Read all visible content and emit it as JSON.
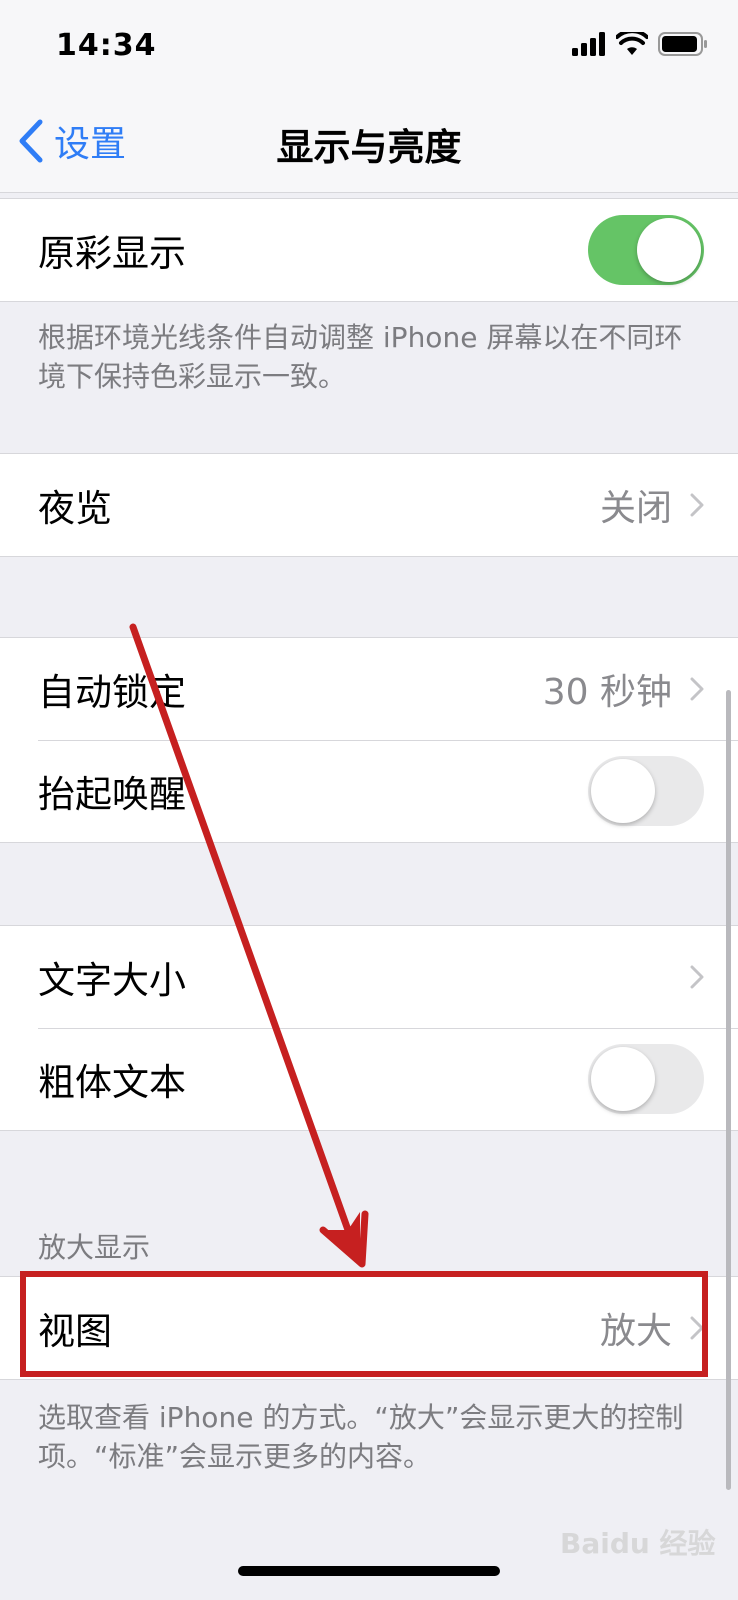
{
  "status_bar": {
    "time": "14:34"
  },
  "nav": {
    "back_label": "设置",
    "title": "显示与亮度"
  },
  "true_tone": {
    "label": "原彩显示",
    "enabled": true,
    "description": "根据环境光线条件自动调整 iPhone 屏幕以在不同环境下保持色彩显示一致。"
  },
  "night_shift": {
    "label": "夜览",
    "value": "关闭"
  },
  "lock_group": {
    "auto_lock": {
      "label": "自动锁定",
      "value": "30 秒钟"
    },
    "raise_to_wake": {
      "label": "抬起唤醒",
      "enabled": false
    }
  },
  "text_group": {
    "text_size": {
      "label": "文字大小"
    },
    "bold_text": {
      "label": "粗体文本",
      "enabled": false
    }
  },
  "zoom": {
    "header": "放大显示",
    "view": {
      "label": "视图",
      "value": "放大"
    },
    "description": "选取查看 iPhone 的方式。“放大”会显示更大的控制项。“标准”会显示更多的内容。"
  },
  "watermark": "Baidu 经验",
  "colors": {
    "accent": "#2f7df6",
    "toggle_on": "#65c466",
    "annotation_red": "#c62020"
  }
}
